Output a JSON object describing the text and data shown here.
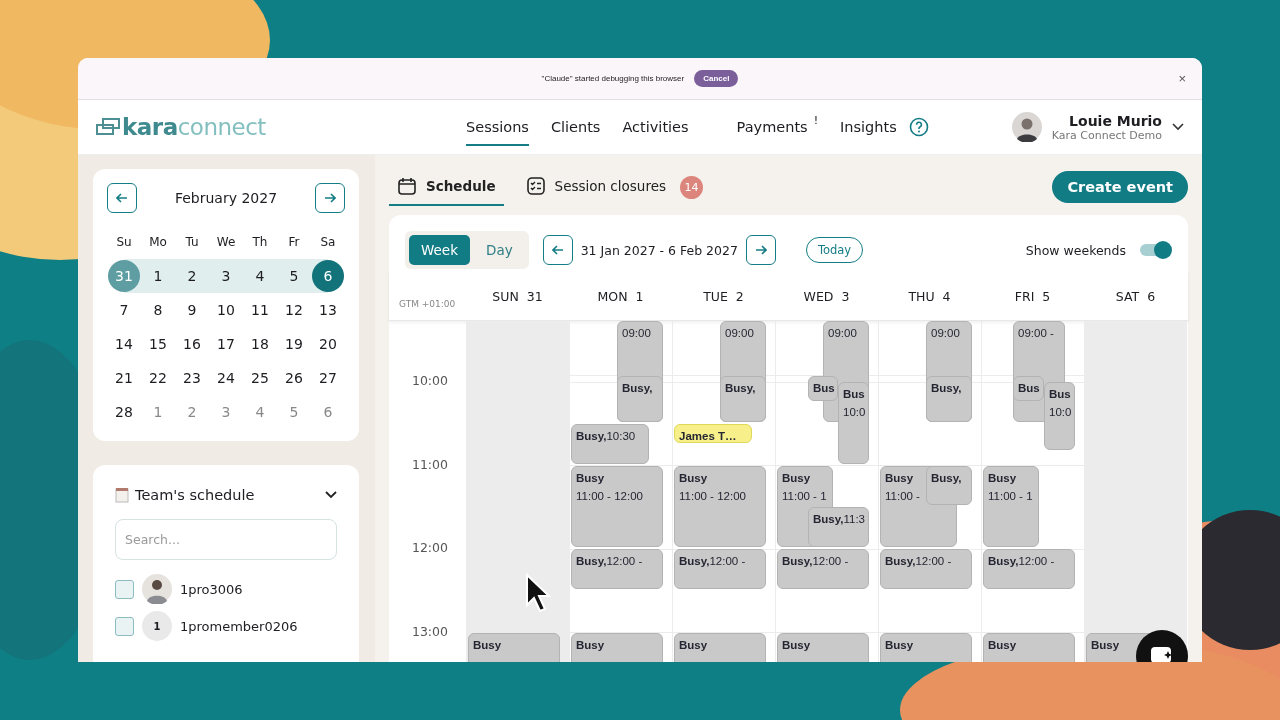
{
  "debug_bar": {
    "message": "\"Claude\" started debugging this browser",
    "cancel": "Cancel",
    "close": "×"
  },
  "header": {
    "logo_a": "kara",
    "logo_b": "connect",
    "nav": [
      {
        "label": "Sessions",
        "selected": true
      },
      {
        "label": "Clients",
        "selected": false
      },
      {
        "label": "Activities",
        "selected": false
      },
      {
        "label": "Payments",
        "selected": false,
        "alert": "!"
      },
      {
        "label": "Insights",
        "selected": false
      }
    ],
    "user": {
      "name": "Louie Murio",
      "org": "Kara Connect Demo"
    }
  },
  "mini_calendar": {
    "month": "February 2027",
    "weekdays": [
      "Su",
      "Mo",
      "Tu",
      "We",
      "Th",
      "Fr",
      "Sa"
    ],
    "days": [
      {
        "label": "31",
        "in_range": true,
        "range_start": true,
        "range_end": false,
        "muted": false
      },
      {
        "label": "1",
        "in_range": true,
        "range_start": false,
        "range_end": false,
        "muted": false
      },
      {
        "label": "2",
        "in_range": true,
        "range_start": false,
        "range_end": false,
        "muted": false
      },
      {
        "label": "3",
        "in_range": true,
        "range_start": false,
        "range_end": false,
        "muted": false
      },
      {
        "label": "4",
        "in_range": true,
        "range_start": false,
        "range_end": false,
        "muted": false
      },
      {
        "label": "5",
        "in_range": true,
        "range_start": false,
        "range_end": false,
        "muted": false
      },
      {
        "label": "6",
        "in_range": true,
        "range_start": false,
        "range_end": true,
        "muted": false
      },
      {
        "label": "7",
        "in_range": false,
        "range_start": false,
        "range_end": false,
        "muted": false
      },
      {
        "label": "8",
        "in_range": false,
        "range_start": false,
        "range_end": false,
        "muted": false
      },
      {
        "label": "9",
        "in_range": false,
        "range_start": false,
        "range_end": false,
        "muted": false
      },
      {
        "label": "10",
        "in_range": false,
        "range_start": false,
        "range_end": false,
        "muted": false
      },
      {
        "label": "11",
        "in_range": false,
        "range_start": false,
        "range_end": false,
        "muted": false
      },
      {
        "label": "12",
        "in_range": false,
        "range_start": false,
        "range_end": false,
        "muted": false
      },
      {
        "label": "13",
        "in_range": false,
        "range_start": false,
        "range_end": false,
        "muted": false
      },
      {
        "label": "14",
        "in_range": false,
        "range_start": false,
        "range_end": false,
        "muted": false
      },
      {
        "label": "15",
        "in_range": false,
        "range_start": false,
        "range_end": false,
        "muted": false
      },
      {
        "label": "16",
        "in_range": false,
        "range_start": false,
        "range_end": false,
        "muted": false
      },
      {
        "label": "17",
        "in_range": false,
        "range_start": false,
        "range_end": false,
        "muted": false
      },
      {
        "label": "18",
        "in_range": false,
        "range_start": false,
        "range_end": false,
        "muted": false
      },
      {
        "label": "19",
        "in_range": false,
        "range_start": false,
        "range_end": false,
        "muted": false
      },
      {
        "label": "20",
        "in_range": false,
        "range_start": false,
        "range_end": false,
        "muted": false
      },
      {
        "label": "21",
        "in_range": false,
        "range_start": false,
        "range_end": false,
        "muted": false
      },
      {
        "label": "22",
        "in_range": false,
        "range_start": false,
        "range_end": false,
        "muted": false
      },
      {
        "label": "23",
        "in_range": false,
        "range_start": false,
        "range_end": false,
        "muted": false
      },
      {
        "label": "24",
        "in_range": false,
        "range_start": false,
        "range_end": false,
        "muted": false
      },
      {
        "label": "25",
        "in_range": false,
        "range_start": false,
        "range_end": false,
        "muted": false
      },
      {
        "label": "26",
        "in_range": false,
        "range_start": false,
        "range_end": false,
        "muted": false
      },
      {
        "label": "27",
        "in_range": false,
        "range_start": false,
        "range_end": false,
        "muted": false
      },
      {
        "label": "28",
        "in_range": false,
        "range_start": false,
        "range_end": false,
        "muted": false
      },
      {
        "label": "1",
        "in_range": false,
        "range_start": false,
        "range_end": false,
        "muted": true
      },
      {
        "label": "2",
        "in_range": false,
        "range_start": false,
        "range_end": false,
        "muted": true
      },
      {
        "label": "3",
        "in_range": false,
        "range_start": false,
        "range_end": false,
        "muted": true
      },
      {
        "label": "4",
        "in_range": false,
        "range_start": false,
        "range_end": false,
        "muted": true
      },
      {
        "label": "5",
        "in_range": false,
        "range_start": false,
        "range_end": false,
        "muted": true
      },
      {
        "label": "6",
        "in_range": false,
        "range_start": false,
        "range_end": false,
        "muted": true
      }
    ]
  },
  "team": {
    "title": "Team's schedule",
    "search": {
      "placeholder": "Search..."
    },
    "members": [
      {
        "name": "1pro3006",
        "checked": false
      },
      {
        "name": "1promember0206",
        "checked": false,
        "kind": "initial",
        "initial": "1"
      }
    ]
  },
  "tabs": [
    {
      "label": "Schedule",
      "selected": true
    },
    {
      "label": "Session closures",
      "selected": false,
      "badge": "14"
    }
  ],
  "create_button": "Create event",
  "toolbar": {
    "views": [
      {
        "label": "Week",
        "selected": true
      },
      {
        "label": "Day",
        "selected": false
      }
    ],
    "range": "31 Jan 2027 - 6 Feb 2027",
    "today": "Today",
    "weekends_label": "Show weekends",
    "weekends_on": true
  },
  "timezone": "GTM +01:00",
  "hours": [
    "10:00",
    "11:00",
    "12:00",
    "13:00"
  ],
  "days": [
    {
      "name": "SUN",
      "date": "31",
      "weekend": true,
      "events": [
        {
          "kind": "stacked",
          "title": "Busy"
        }
      ]
    },
    {
      "name": "MON",
      "date": "1",
      "weekend": false,
      "events": [
        {
          "kind": "time-only",
          "time": "09:00"
        },
        {
          "kind": "inline",
          "title": "Busy,"
        },
        {
          "kind": "inline",
          "title": "Busy,",
          "time": "10:30"
        },
        {
          "kind": "stacked",
          "title": "Busy",
          "time": "11:00 - 12:00"
        },
        {
          "kind": "inline",
          "title": "Busy,",
          "time": "12:00 -"
        },
        {
          "kind": "stacked",
          "title": "Busy"
        }
      ]
    },
    {
      "name": "TUE",
      "date": "2",
      "weekend": false,
      "events": [
        {
          "kind": "time-only",
          "time": "09:00"
        },
        {
          "kind": "inline",
          "title": "Busy,"
        },
        {
          "kind": "highlight",
          "title": "James T…"
        },
        {
          "kind": "stacked",
          "title": "Busy",
          "time": "11:00 - 12:00"
        },
        {
          "kind": "inline",
          "title": "Busy,",
          "time": "12:00 -"
        },
        {
          "kind": "stacked",
          "title": "Busy"
        }
      ]
    },
    {
      "name": "WED",
      "date": "3",
      "weekend": false,
      "events": [
        {
          "kind": "time-only",
          "time": "09:00"
        },
        {
          "kind": "inline",
          "title": "Bus"
        },
        {
          "kind": "stacked",
          "title": "Bus",
          "time": "10:0"
        },
        {
          "kind": "stacked",
          "title": "Busy",
          "time": "11:00 - 1"
        },
        {
          "kind": "inline",
          "title": "Busy,",
          "time": "11:3"
        },
        {
          "kind": "inline",
          "title": "Busy,",
          "time": "12:00 -"
        },
        {
          "kind": "stacked",
          "title": "Busy"
        }
      ]
    },
    {
      "name": "THU",
      "date": "4",
      "weekend": false,
      "events": [
        {
          "kind": "time-only",
          "time": "09:00"
        },
        {
          "kind": "inline",
          "title": "Busy,"
        },
        {
          "kind": "stacked",
          "title": "Busy",
          "time": "11:00 -"
        },
        {
          "kind": "inline",
          "title": "Busy,"
        },
        {
          "kind": "inline",
          "title": "Busy,",
          "time": "12:00 -"
        },
        {
          "kind": "stacked",
          "title": "Busy"
        }
      ]
    },
    {
      "name": "FRI",
      "date": "5",
      "weekend": false,
      "events": [
        {
          "kind": "time-only",
          "time": "09:00 -"
        },
        {
          "kind": "inline",
          "title": "Bus"
        },
        {
          "kind": "stacked",
          "title": "Bus",
          "time": "10:0"
        },
        {
          "kind": "stacked",
          "title": "Busy",
          "time": "11:00 - 1"
        },
        {
          "kind": "inline",
          "title": "Busy,",
          "time": "12:00 -"
        },
        {
          "kind": "stacked",
          "title": "Busy"
        }
      ]
    },
    {
      "name": "SAT",
      "date": "6",
      "weekend": true,
      "events": [
        {
          "kind": "stacked",
          "title": "Busy"
        }
      ]
    }
  ]
}
